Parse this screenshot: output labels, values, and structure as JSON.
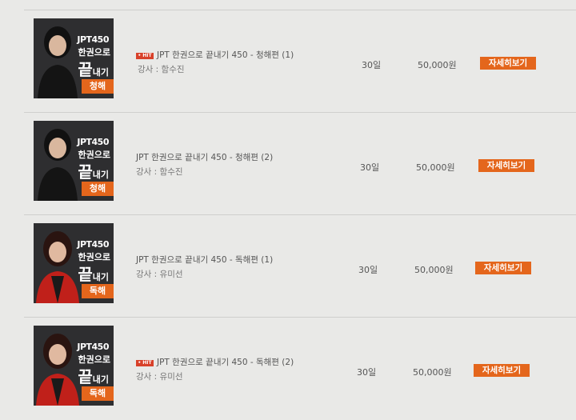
{
  "courses": [
    {
      "hot_badge": "• HIT",
      "title": "JPT 한권으로 끝내기 450 - 청해편 (1)",
      "teacher": "강사 : 함수진",
      "days": "30일",
      "price": "50,000원",
      "button": "자세히보기",
      "thumb": {
        "line1": "JPT450",
        "line2": "한권으로",
        "line3a": "끝",
        "line3b": "내기",
        "tag": "청해"
      }
    },
    {
      "title": "JPT 한권으로 끝내기 450 - 청해편 (2)",
      "teacher": "강사 : 함수진",
      "days": "30일",
      "price": "50,000원",
      "button": "자세히보기",
      "thumb": {
        "line1": "JPT450",
        "line2": "한권으로",
        "line3a": "끝",
        "line3b": "내기",
        "tag": "청해"
      }
    },
    {
      "title": "JPT 한권으로 끝내기 450 - 독해편 (1)",
      "teacher": "강사 : 유미선",
      "days": "30일",
      "price": "50,000원",
      "button": "자세히보기",
      "thumb": {
        "line1": "JPT450",
        "line2": "한권으로",
        "line3a": "끝",
        "line3b": "내기",
        "tag": "독해"
      }
    },
    {
      "hot_badge": "• HIT",
      "title": "JPT 한권으로 끝내기 450 - 독해편 (2)",
      "teacher": "강사 : 유미선",
      "days": "30일",
      "price": "50,000원",
      "button": "자세히보기",
      "thumb": {
        "line1": "JPT450",
        "line2": "한권으로",
        "line3a": "끝",
        "line3b": "내기",
        "tag": "독해"
      }
    }
  ],
  "colors": {
    "accent": "#e4661c",
    "hot": "#d8412a",
    "background": "#e9e9e7"
  }
}
